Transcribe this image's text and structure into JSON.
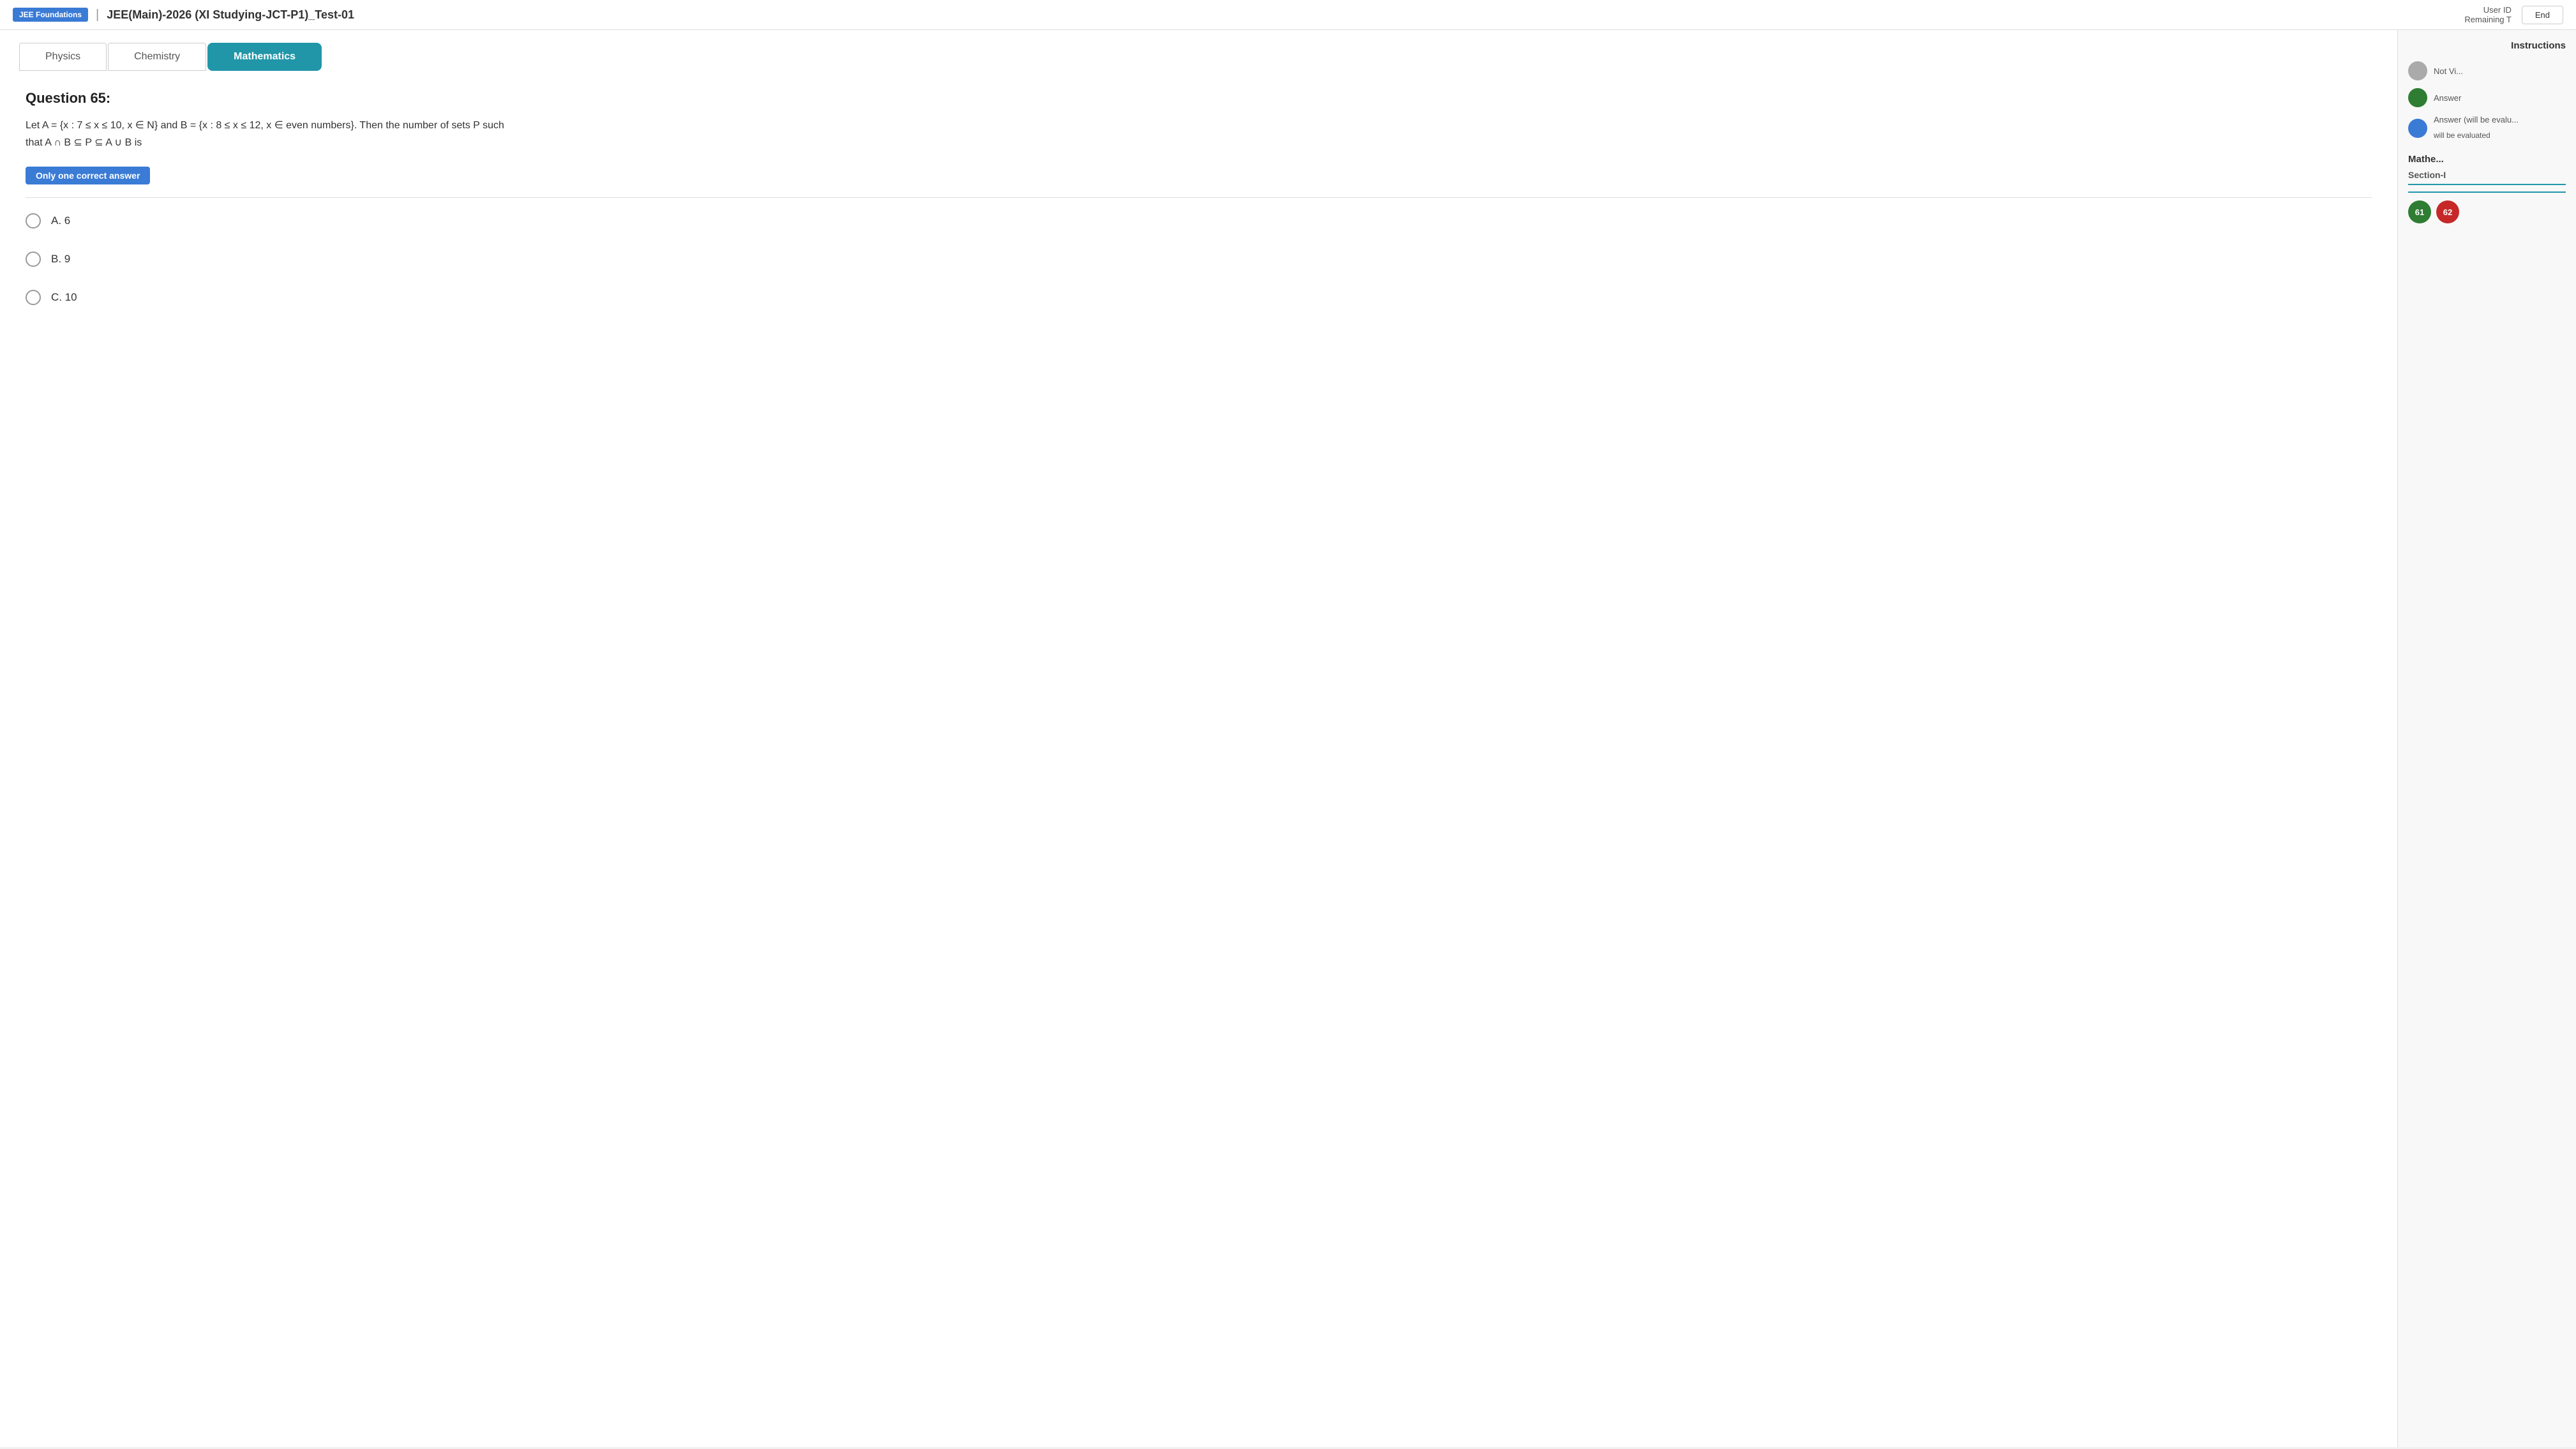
{
  "header": {
    "brand": "JEE Foundations",
    "title": "JEE(Main)-2026 (XI Studying-JCT-P1)_Test-01",
    "user_id_label": "User ID",
    "remaining_label": "Remaining T",
    "end_button": "End"
  },
  "tabs": [
    {
      "id": "physics",
      "label": "Physics",
      "active": false
    },
    {
      "id": "chemistry",
      "label": "Chemistry",
      "active": false
    },
    {
      "id": "mathematics",
      "label": "Mathematics",
      "active": true
    }
  ],
  "question": {
    "number": "Question 65:",
    "text_line1": "Let A = {x : 7 ≤ x ≤ 10, x ∈ N} and B = {x : 8 ≤ x ≤ 12, x ∈ even numbers}. Then the number of sets P such",
    "text_line2": "that A ∩ B ⊆ P ⊆ A ∪ B is",
    "answer_type": "Only one correct answer"
  },
  "options": [
    {
      "id": "A",
      "label": "A. 6"
    },
    {
      "id": "B",
      "label": "B. 9"
    },
    {
      "id": "C",
      "label": "C. 10"
    }
  ],
  "sidebar": {
    "instructions_label": "Instructions",
    "legend": [
      {
        "color": "gray",
        "text": "Not Vi..."
      },
      {
        "color": "green",
        "text": "Answer"
      },
      {
        "color": "blue",
        "text": "Answer (will be evalu..."
      }
    ],
    "math_section_label": "Mathe...",
    "section_label": "Section-I",
    "question_numbers": [
      {
        "num": "61",
        "status": "dark"
      },
      {
        "num": "62",
        "status": "red"
      }
    ]
  }
}
